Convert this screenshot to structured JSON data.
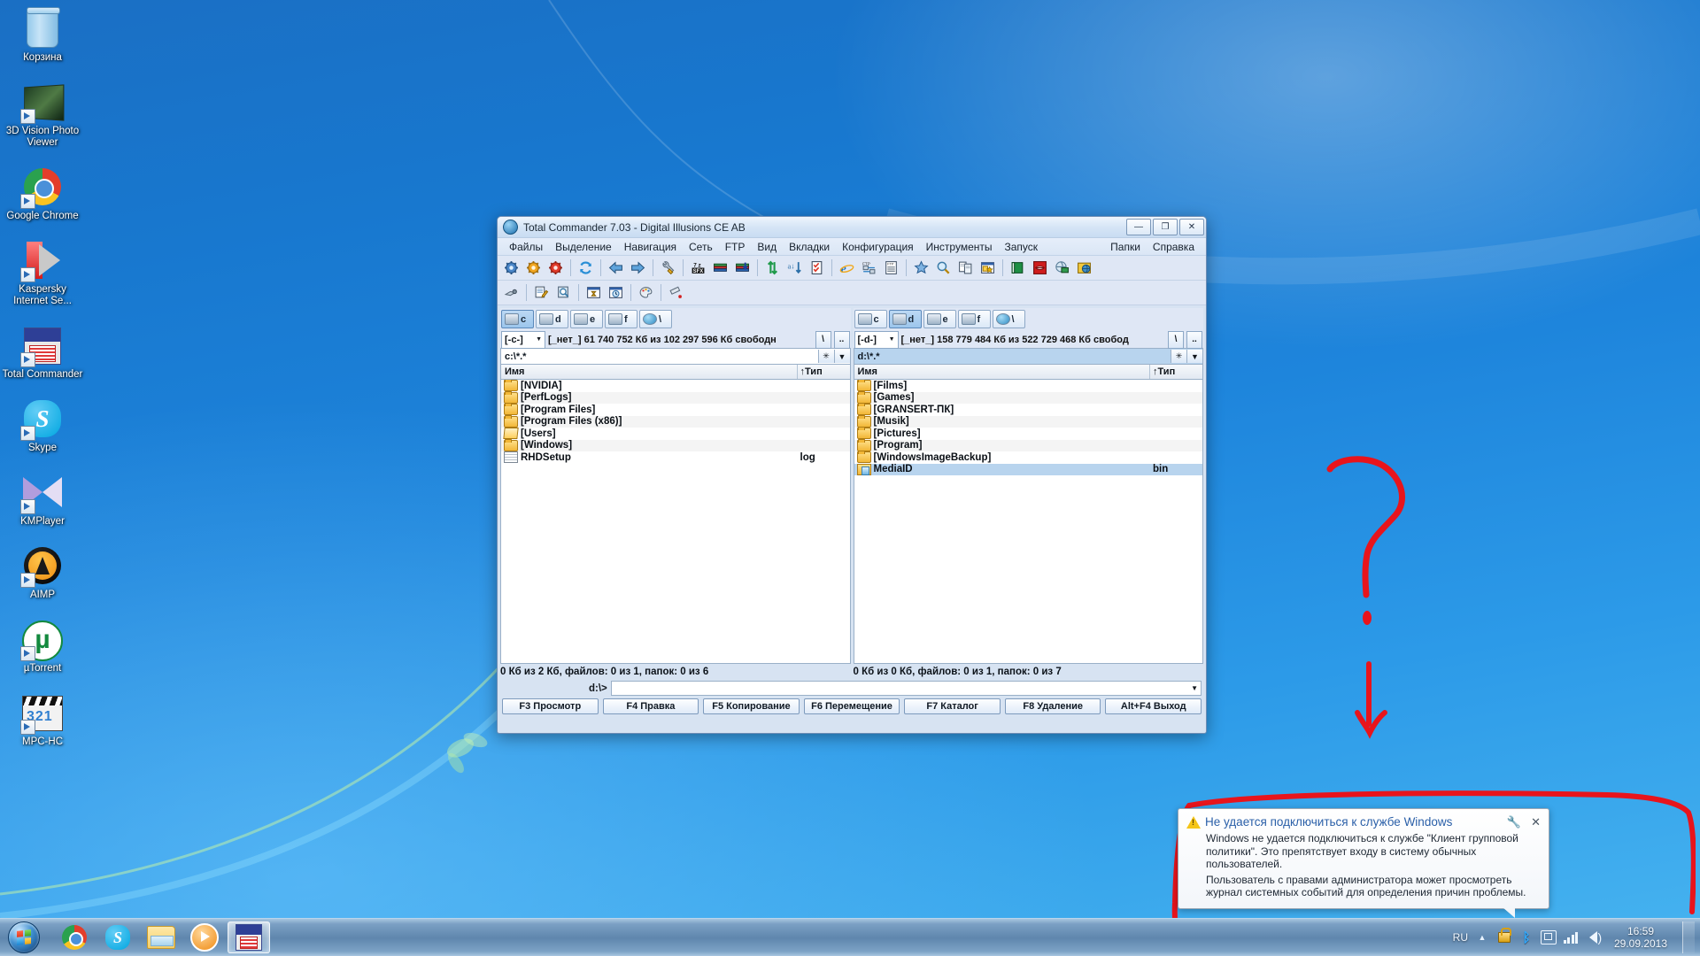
{
  "desktop": {
    "icons": [
      {
        "label": "Корзина",
        "icon": "recycle-bin-icon",
        "art": "bin",
        "shortcut": false
      },
      {
        "label": "3D Vision\nPhoto Viewer",
        "icon": "3d-vision-photo-viewer-icon",
        "art": "v3d",
        "shortcut": true
      },
      {
        "label": "Google\nChrome",
        "icon": "google-chrome-icon",
        "art": "chrome",
        "shortcut": true
      },
      {
        "label": "Kaspersky\nInternet Se...",
        "icon": "kaspersky-icon",
        "art": "kas",
        "shortcut": true
      },
      {
        "label": "Total\nCommander",
        "icon": "total-commander-icon",
        "art": "tc",
        "shortcut": true
      },
      {
        "label": "Skype",
        "icon": "skype-icon",
        "art": "skype",
        "shortcut": true
      },
      {
        "label": "KMPlayer",
        "icon": "kmplayer-icon",
        "art": "km",
        "shortcut": true
      },
      {
        "label": "AIMP",
        "icon": "aimp-icon",
        "art": "aimp",
        "shortcut": true
      },
      {
        "label": "µTorrent",
        "icon": "utorrent-icon",
        "art": "ut",
        "shortcut": true
      },
      {
        "label": "MPC-HC",
        "icon": "mpc-hc-icon",
        "art": "mpc",
        "shortcut": true
      }
    ],
    "annotations": {
      "question_mark": "?",
      "arrow": "down-arrow",
      "highlight_box": "rectangle around notification balloon",
      "color": "#e8141c"
    }
  },
  "window": {
    "title": "Total Commander 7.03 - Digital Illusions CE AB",
    "app_icon": "total-commander-icon",
    "controls": {
      "minimize": "—",
      "maximize": "❐",
      "close": "✕"
    },
    "menu": [
      "Файлы",
      "Выделение",
      "Навигация",
      "Сеть",
      "FTP",
      "Вид",
      "Вкладки",
      "Конфигурация",
      "Инструменты",
      "Запуск"
    ],
    "menu_right": [
      "Папки",
      "Справка"
    ],
    "toolbar_row1": [
      "blue-gear-icon",
      "orange-gear-icon",
      "red-gear-icon",
      "sep",
      "refresh-icon",
      "sep",
      "back-arrow-icon",
      "forward-arrow-icon",
      "sep",
      "wrench-icon",
      "sep",
      "7zip-sfx-icon",
      "pack-icon",
      "unpack-icon",
      "sep",
      "sync-vertical-icon",
      "sort-icon",
      "checklist-icon",
      "sep",
      "internet-explorer-icon",
      "ftp-connect-icon",
      "ftp-list-icon",
      "sep",
      "star-icon",
      "search-icon",
      "compare-icon",
      "multi-rename-icon",
      "sep",
      "green-book-icon",
      "red-lips-icon",
      "globe-money-icon",
      "yellow-globe-icon"
    ],
    "toolbar_row2": [
      "plug-icon",
      "sep",
      "edit-tools-icon",
      "zoom-doc-icon",
      "sep",
      "hourglass-window-icon",
      "clock-window-icon",
      "sep",
      "palette-icon",
      "sep",
      "eject-usb-icon"
    ]
  },
  "left_pane": {
    "drives": [
      {
        "letter": "c",
        "icon": "hdd-icon",
        "active": true
      },
      {
        "letter": "d",
        "icon": "hdd-icon",
        "active": false
      },
      {
        "letter": "e",
        "icon": "cd-icon",
        "active": false
      },
      {
        "letter": "f",
        "icon": "cd-icon",
        "active": false
      },
      {
        "letter": "\\",
        "icon": "network-icon",
        "active": false
      }
    ],
    "drive_combo": "[-c-]",
    "drive_info": "[_нет_]  61 740 752 Кб из 102 297 596 Кб свободн",
    "path": "c:\\*.*",
    "active": false,
    "columns": {
      "name": "Имя",
      "type": "↑Тип"
    },
    "files": [
      {
        "name": "[NVIDIA]",
        "type": "",
        "icon": "folder-icon",
        "kind": "folder",
        "selected": false
      },
      {
        "name": "[PerfLogs]",
        "type": "",
        "icon": "folder-icon",
        "kind": "folder",
        "selected": false
      },
      {
        "name": "[Program Files]",
        "type": "",
        "icon": "folder-icon",
        "kind": "folder",
        "selected": false
      },
      {
        "name": "[Program Files (x86)]",
        "type": "",
        "icon": "folder-icon",
        "kind": "folder",
        "selected": false
      },
      {
        "name": "[Users]",
        "type": "",
        "icon": "folder-open-icon",
        "kind": "folderopen",
        "selected": false
      },
      {
        "name": "[Windows]",
        "type": "",
        "icon": "folder-icon",
        "kind": "folder",
        "selected": false
      },
      {
        "name": "RHDSetup",
        "type": "log",
        "icon": "document-icon",
        "kind": "doc",
        "selected": false
      }
    ],
    "status": "0 Кб из 2 Кб, файлов: 0 из 1, папок: 0 из 6"
  },
  "right_pane": {
    "drives": [
      {
        "letter": "c",
        "icon": "hdd-icon",
        "active": false
      },
      {
        "letter": "d",
        "icon": "hdd-icon",
        "active": true
      },
      {
        "letter": "e",
        "icon": "cd-icon",
        "active": false
      },
      {
        "letter": "f",
        "icon": "cd-icon",
        "active": false
      },
      {
        "letter": "\\",
        "icon": "network-icon",
        "active": false
      }
    ],
    "drive_combo": "[-d-]",
    "drive_info": "[_нет_]  158 779 484 Кб из 522 729 468 Кб свобод",
    "path": "d:\\*.*",
    "active": true,
    "columns": {
      "name": "Имя",
      "type": "↑Тип"
    },
    "files": [
      {
        "name": "[Films]",
        "type": "",
        "icon": "folder-icon",
        "kind": "folder",
        "selected": false
      },
      {
        "name": "[Games]",
        "type": "",
        "icon": "folder-icon",
        "kind": "folder",
        "selected": false
      },
      {
        "name": "[GRANSERT-ПК]",
        "type": "",
        "icon": "folder-icon",
        "kind": "folder",
        "selected": false
      },
      {
        "name": "[Musik]",
        "type": "",
        "icon": "folder-icon",
        "kind": "folder",
        "selected": false
      },
      {
        "name": "[Pictures]",
        "type": "",
        "icon": "folder-icon",
        "kind": "folder",
        "selected": false
      },
      {
        "name": "[Program]",
        "type": "",
        "icon": "folder-icon",
        "kind": "folder",
        "selected": false
      },
      {
        "name": "[WindowsImageBackup]",
        "type": "",
        "icon": "folder-icon",
        "kind": "folder",
        "selected": false
      },
      {
        "name": "MediaID",
        "type": "bin",
        "icon": "binary-file-icon",
        "kind": "bin",
        "selected": true
      }
    ],
    "status": "0 Кб из 0 Кб, файлов: 0 из 1, папок: 0 из 7"
  },
  "command_line": {
    "prompt": "d:\\>",
    "value": "",
    "dropdown_icon": "chevron-down-icon"
  },
  "function_keys": [
    "F3 Просмотр",
    "F4 Правка",
    "F5 Копирование",
    "F6 Перемещение",
    "F7 Каталог",
    "F8 Удаление",
    "Alt+F4 Выход"
  ],
  "balloon": {
    "warning_icon": "warning-triangle-icon",
    "title": "Не удается подключиться к службе Windows",
    "tool_icon": "wrench-icon",
    "close_icon": "close-icon",
    "body_line1": "Windows не удается подключиться к службе \"Клиент групповой политики\". Это препятствует входу в систему обычных пользователей.",
    "body_line2": "Пользователь с правами администратора может просмотреть журнал системных событий для определения причин проблемы."
  },
  "taskbar": {
    "start_icon": "windows-start-orb",
    "tasks": [
      {
        "name": "google-chrome-taskbar-icon",
        "art": "chrome",
        "active": false
      },
      {
        "name": "skype-taskbar-icon",
        "art": "skype",
        "active": false
      },
      {
        "name": "file-explorer-taskbar-icon",
        "art": "explorer",
        "active": false
      },
      {
        "name": "windows-media-player-taskbar-icon",
        "art": "wmp",
        "active": false
      },
      {
        "name": "total-commander-taskbar-icon",
        "art": "tc",
        "active": true
      }
    ],
    "tray": {
      "language": "RU",
      "show_hidden_icon": "chevron-up-icon",
      "icons": [
        "lock-icon",
        "bluetooth-icon",
        "safely-remove-hardware-icon",
        "network-signal-icon",
        "volume-icon"
      ],
      "time": "16:59",
      "date": "29.09.2013",
      "show_desktop": "show-desktop-button"
    }
  }
}
